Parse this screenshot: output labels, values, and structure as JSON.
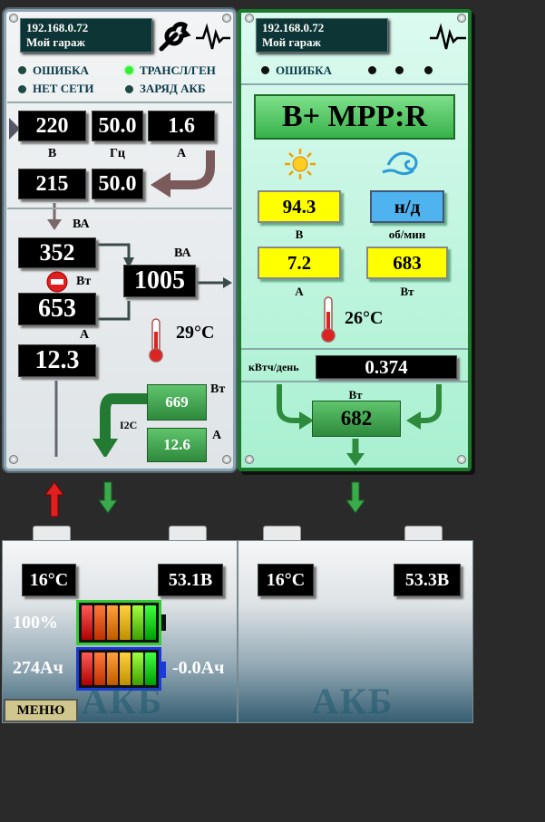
{
  "inverter": {
    "ip": "192.168.0.72",
    "name": "Мой гараж",
    "status": {
      "error": "ОШИБКА",
      "no_grid": "НЕТ СЕТИ",
      "transl_gen": "ТРАНСЛ/ГЕН",
      "charge": "ЗАРЯД АКБ"
    },
    "input_voltage": "220",
    "input_freq": "50.0",
    "input_current": "1.6",
    "unit_v": "В",
    "unit_hz": "Гц",
    "unit_a": "А",
    "output_voltage": "215",
    "output_freq": "50.0",
    "apparent_power": "352",
    "unit_va": "ВА",
    "active_power": "653",
    "unit_w": "Вт",
    "total_va": "1005",
    "current": "12.3",
    "temperature": "29°C",
    "bus_power": "669",
    "bus_current": "12.6",
    "bus_label": "I2C"
  },
  "mppt": {
    "ip": "192.168.0.72",
    "name": "Мой гараж",
    "error": "ОШИБКА",
    "mode": "B+ MPP:R",
    "voltage": "94.3",
    "unit_v": "В",
    "rpm": "н/д",
    "unit_rpm": "об/мин",
    "current": "7.2",
    "unit_a": "А",
    "power": "683",
    "unit_w": "Вт",
    "temperature": "26°C",
    "energy_label": "кВтч/день",
    "energy_value": "0.374",
    "out_power_unit": "Вт",
    "out_power": "682"
  },
  "battery1": {
    "temp": "16°C",
    "voltage": "53.1В",
    "soc": "100%",
    "capacity": "274Ач",
    "delta": "-0.0Ач",
    "label": "АКБ",
    "charge_level": 1.0
  },
  "battery2": {
    "temp": "16°C",
    "voltage": "53.3В",
    "label": "АКБ"
  },
  "menu_label": "МЕНЮ",
  "colors": {
    "mppt_border": "#1a7a2a",
    "indicator_on": "#33ee33",
    "indicator_off": "#1f4a44",
    "value_yellow": "#ffff00",
    "value_blue": "#4fb3f0"
  },
  "icons": [
    "wrench-icon",
    "pulse-icon",
    "sun-icon",
    "wind-icon",
    "thermometer-icon",
    "stop-icon",
    "arrow-up-icon",
    "arrow-down-icon"
  ]
}
